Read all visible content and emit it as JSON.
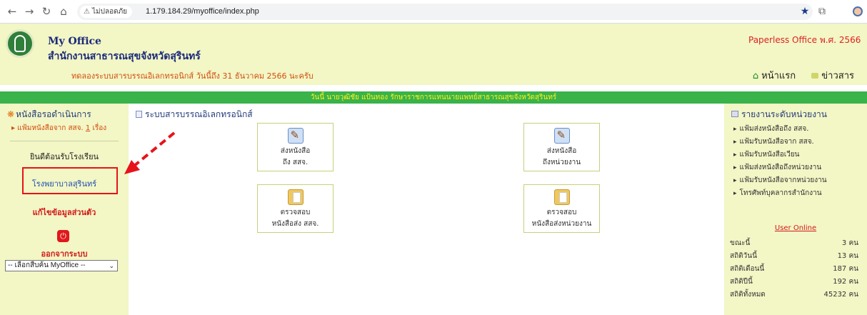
{
  "browser": {
    "security_label": "ไม่ปลอดภัย",
    "url": "1.179.184.29/myoffice/index.php"
  },
  "header": {
    "title": "My Office",
    "org_name": "สำนักงานสาธารณสุขจังหวัดสุรินทร์",
    "tagline": "Paperless Office พ.ศ. 2566",
    "notice": "ทดลองระบบสารบรรณอิเลกทรอนิกส์ วันนี้ถึง 31 ธันวาคม 2566 นะครับ",
    "nav": {
      "home": "หน้าแรก",
      "news": "ข่าวสาร"
    }
  },
  "banner": "วันนี้ นายวุฒิชัย แป้นทอง รักษาราชการแทนนายแพทย์สาธารณสุขจังหวัดสุรินทร์",
  "left": {
    "title": "หนังสือรอดำเนินการ",
    "pending_prefix": "แฟ้มหนังสือจาก สสจ.",
    "pending_count": "1",
    "pending_suffix": "เรื่อง",
    "welcome": "ยินดีต้อนรับโรงเรียน",
    "user_org": "โรงพยาบาลสุรินทร์",
    "edit_profile": "แก้ไขข้อมูลส่วนตัว",
    "logout": "ออกจากระบบ",
    "select_value": "-- เลือกสืบค้น MyOffice --"
  },
  "center": {
    "title": "ระบบสารบรรณอิเลกทรอนิกส์",
    "tiles": [
      {
        "line1": "ส่งหนังสือ",
        "line2": "ถึง สสจ.",
        "icon": "pen-paper-icon"
      },
      {
        "line1": "ส่งหนังสือ",
        "line2": "ถึงหน่วยงาน",
        "icon": "pen-paper-icon"
      },
      {
        "line1": "ตรวจสอบ",
        "line2": "หนังสือส่ง สสจ.",
        "icon": "folder-icon"
      },
      {
        "line1": "ตรวจสอบ",
        "line2": "หนังสือส่งหน่วยงาน",
        "icon": "folder-icon"
      }
    ]
  },
  "right": {
    "title": "รายงานระดับหน่วยงาน",
    "links": [
      "แฟ้มส่งหนังสือถึง สสจ.",
      "แฟ้มรับหนังสือจาก สสจ.",
      "แฟ้มรับหนังสือเวียน",
      "แฟ้มส่งหนังสือถึงหน่วยงาน",
      "แฟ้มรับหนังสือจากหน่วยงาน",
      "โทรศัพท์บุคลากรสำนักงาน"
    ],
    "online_label": "User Online",
    "stats": [
      {
        "label": "ขณะนี้",
        "value": "3 คน"
      },
      {
        "label": "สถิติวันนี้",
        "value": "13 คน"
      },
      {
        "label": "สถิติเดือนนี้",
        "value": "187 คน"
      },
      {
        "label": "สถิติปีนี้",
        "value": "192 คน"
      },
      {
        "label": "สถิติทั้งหมด",
        "value": "45232 คน"
      }
    ]
  },
  "colors": {
    "header_bg": "#f3f6c5",
    "banner_bg": "#39b34a",
    "banner_text": "#ffef1a",
    "highlight": "#e6141a"
  }
}
